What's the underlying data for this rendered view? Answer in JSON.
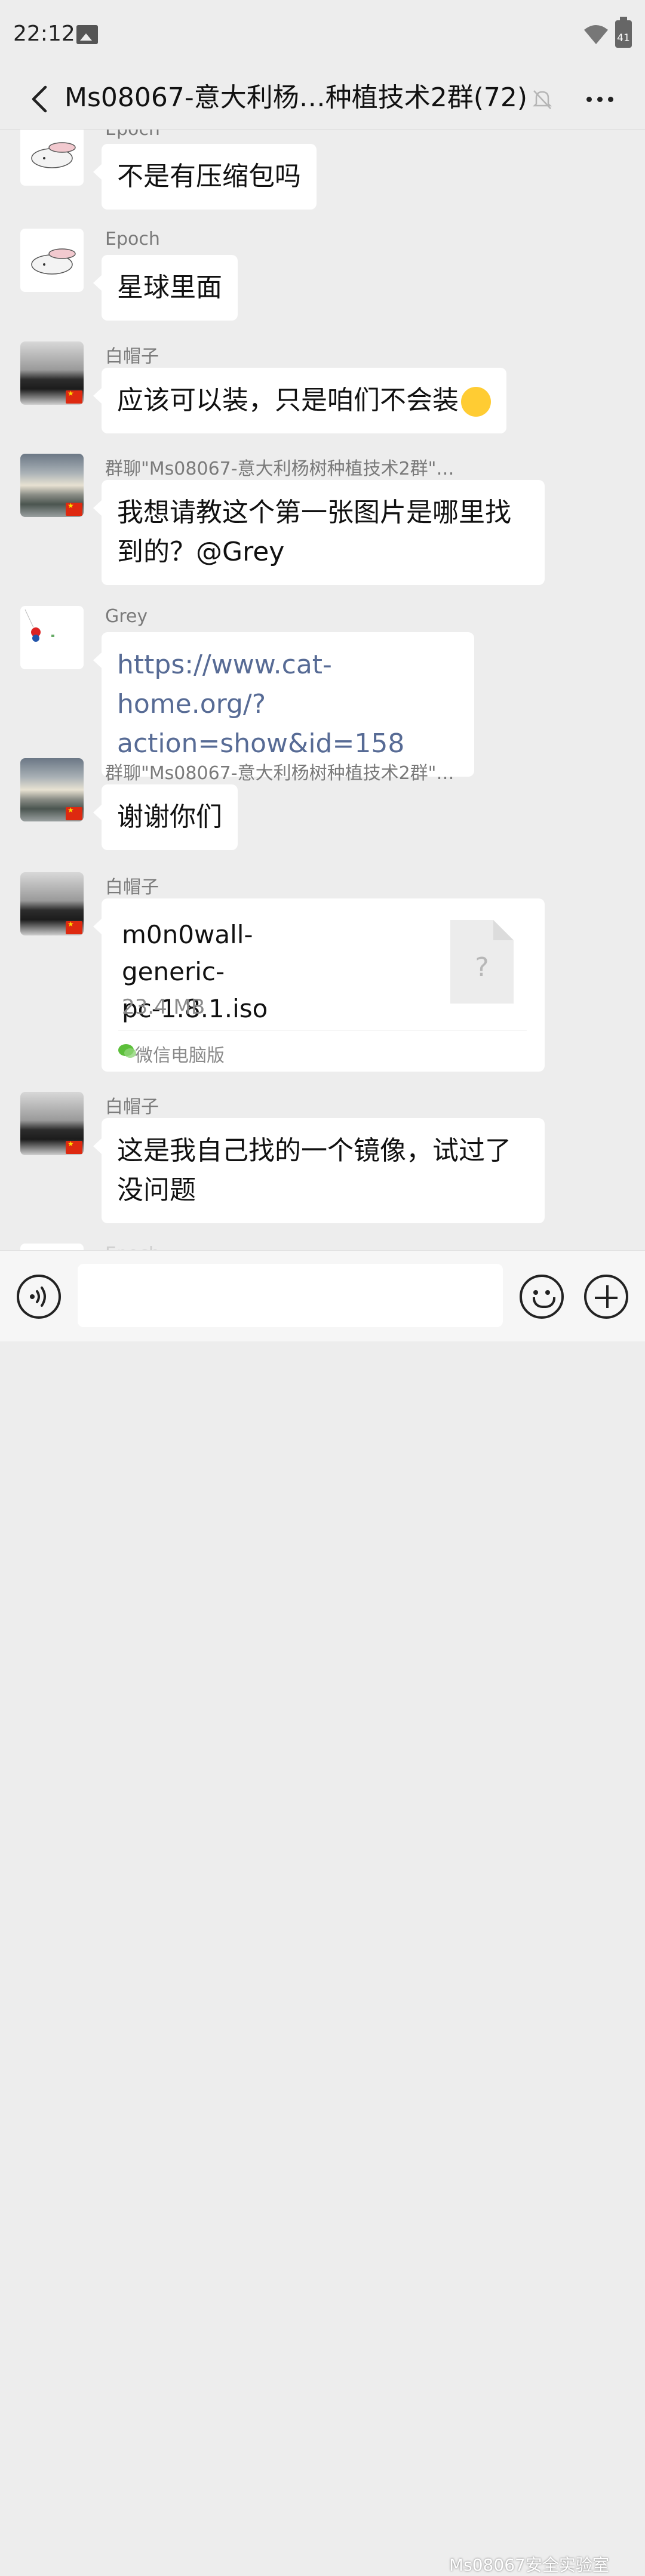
{
  "status_bar": {
    "time": "22:12",
    "battery": "41"
  },
  "header": {
    "title": "Ms08067-意大利杨…种植技术2群(72)"
  },
  "messages": [
    {
      "sender": "Epoch",
      "text": "不是有压缩包吗"
    },
    {
      "sender": "Epoch",
      "text": "星球里面"
    },
    {
      "sender": "白帽子",
      "text": "应该可以装，只是咱们不会装"
    },
    {
      "sender": "群聊\"Ms08067-意大利杨树种植技术2群\"…",
      "text_line1": "我想请教这个第一张图片是哪里找",
      "text_line2": "到的？@Grey"
    },
    {
      "sender": "Grey",
      "text_line1": "https://www.cat-home.org/?",
      "text_line2": "action=show&id=158"
    },
    {
      "sender": "群聊\"Ms08067-意大利杨树种植技术2群\"…",
      "text": "谢谢你们"
    },
    {
      "sender": "白帽子",
      "file_name_line1": "m0n0wall-generic-",
      "file_name_line2": "pc-1.8.1.iso",
      "file_size": "23.4 MB",
      "file_icon": "?",
      "source": "微信电脑版"
    },
    {
      "sender": "白帽子",
      "text_line1": "这是我自己找的一个镜像，试过了",
      "text_line2": "没问题"
    }
  ],
  "partial_sender": "Epoch",
  "input_bar": {
    "placeholder": ""
  },
  "watermark": "Ms08067安全实验室",
  "icons": [
    "back-icon",
    "mute-icon",
    "more-icon",
    "voice-icon",
    "emoji-icon",
    "plus-icon"
  ],
  "colors": {
    "background": "#ededed",
    "bubble": "#ffffff",
    "link": "#576b95",
    "sender": "#7a7a7a"
  }
}
